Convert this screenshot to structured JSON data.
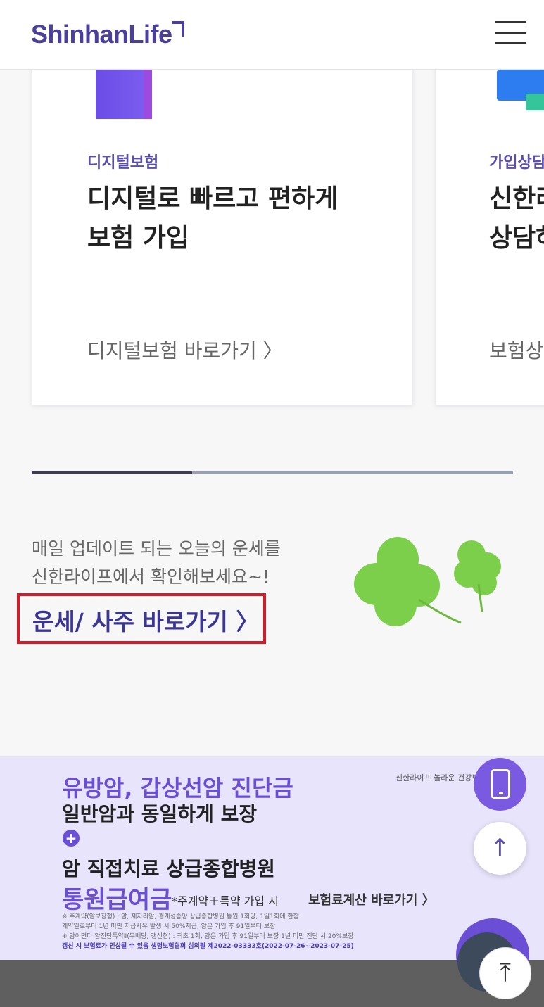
{
  "header": {
    "logo": "ShinhanLife",
    "menu_icon": "hamburger-menu-icon"
  },
  "cards": [
    {
      "tag": "디지털보험",
      "title_line1": "디지털로 빠르고 편하게",
      "title_line2": "보험 가입",
      "link": "디지털보험 바로가기 〉"
    },
    {
      "tag": "가입상담",
      "title_line1": "신한라",
      "title_line2": "상담하",
      "link": "보험상"
    }
  ],
  "fortune": {
    "line1": "매일 업데이트 되는 오늘의 운세를",
    "line2": "신한라이프에서 확인해보세요~!",
    "link": "운세/ 사주 바로가기 〉",
    "image_icon": "clover-icon"
  },
  "banner": {
    "line1": "유방암, 갑상선암 진단금",
    "line2": "일반암과 동일하게 보장",
    "line3": "암 직접치료 상급종합병원",
    "line4": "통원급여금",
    "note": "*주계약＋특약 가입 시",
    "calc_link": "보험료계산 바로가기 〉",
    "top_right": "신한라이프 놀라운 건강보",
    "fine1": "※ 주계약(암보장형) : 암, 제자리암, 경계성종양 상급종합병원 통원 1회당, 1일1회에 한함",
    "fine2": "계약일로부터 1년 미만 지급사유 발생 시 50%지급, 암은 가입 후 91일부터 보장",
    "fine3": "※ 암이면다 암진단특약Ⅱ(무배당, 갱신형) : 최초 1회, 암은 가입 후 91일부터 보장 1년 미만 진단 시 20%보장",
    "fine4": "갱신 시 보험료가 인상될 수 있음 생명보험협회 심의필 제2022-03333호(2022-07-26~2023-07-25)"
  },
  "fabs": {
    "phone_icon": "phone-icon",
    "up_icon": "arrow-up-icon",
    "top": "⤒",
    "up": "↑"
  }
}
